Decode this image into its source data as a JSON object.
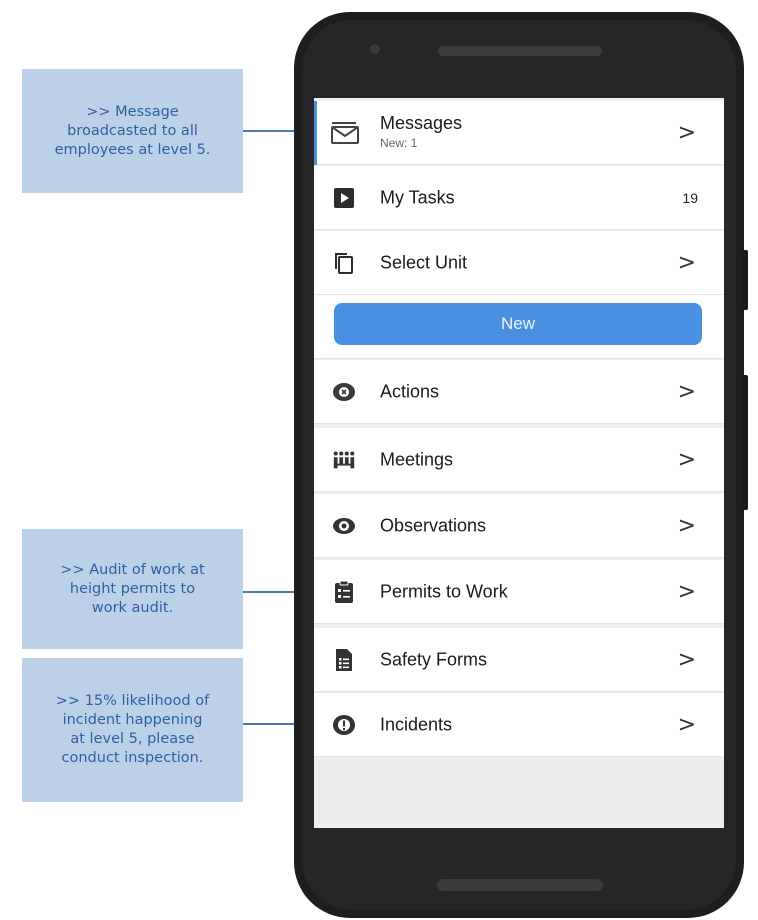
{
  "callouts": [
    {
      "lines": [
        ">> Message",
        "broadcasted to all",
        "employees at level 5."
      ]
    },
    {
      "lines": [
        ">> Audit of work at",
        "height permits to",
        "work audit."
      ]
    },
    {
      "lines": [
        ">> 15% likelihood of",
        "incident happening",
        "at level 5, please",
        "conduct inspection."
      ]
    }
  ],
  "menu": {
    "messages": {
      "label": "Messages",
      "sub": "New: 1",
      "icon": "envelope-icon"
    },
    "my_tasks": {
      "label": "My Tasks",
      "count": "19",
      "icon": "play-square-icon"
    },
    "select_unit": {
      "label": "Select Unit",
      "icon": "copy-pages-icon"
    },
    "new_button": "New",
    "actions": {
      "label": "Actions",
      "icon": "circle-x-icon"
    },
    "meetings": {
      "label": "Meetings",
      "icon": "people-group-icon"
    },
    "observations": {
      "label": "Observations",
      "icon": "eye-icon"
    },
    "permits": {
      "label": "Permits to Work",
      "icon": "clipboard-icon"
    },
    "safety_forms": {
      "label": "Safety Forms",
      "icon": "form-document-icon"
    },
    "incidents": {
      "label": "Incidents",
      "icon": "alert-circle-icon"
    },
    "chevron": ">"
  },
  "colors": {
    "accent": "#4a90e2",
    "callout_bg": "#bcd1e8",
    "callout_text": "#2f5fa0"
  }
}
